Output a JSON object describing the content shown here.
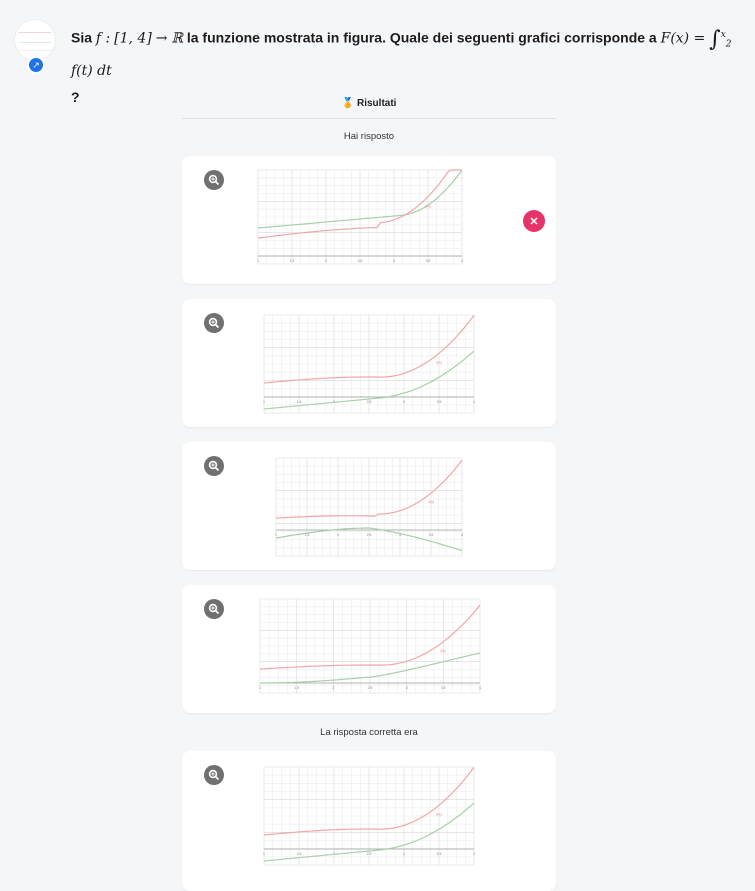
{
  "question": {
    "prefix": "Sia",
    "f_name": "f",
    "domain": "[1, 4]",
    "arrow": "→",
    "codomain": "ℝ",
    "text": "la funzione mostrata in figura. Quale dei seguenti grafici corrisponde a",
    "F_expr": "F(x) =",
    "integral_sign": "∫",
    "upper": "x",
    "lower": "2",
    "integrand": "f(t) dt",
    "suffix": "?"
  },
  "results": {
    "title": "Risultati",
    "icon": "badge-icon",
    "answered_label": "Hai risposto",
    "correct_label": "La risposta corretta era"
  },
  "colors": {
    "f_curve": "#f2a7a7",
    "F_curve": "#a9cfa9",
    "wrong": "#e8336a",
    "zoom": "#707070"
  },
  "cards": [
    {
      "id": "option-1",
      "fx_label": "f(x)",
      "marked": "wrong",
      "ticks": [
        "1",
        "1.5",
        "2",
        "2.5",
        "3",
        "3.5",
        "4"
      ]
    },
    {
      "id": "option-2",
      "fx_label": "f(x)",
      "ticks": [
        "1",
        "1.5",
        "2",
        "2.5",
        "3",
        "3.5",
        "4"
      ]
    },
    {
      "id": "option-3",
      "fx_label": "f(x)",
      "ticks": [
        "1",
        "1.5",
        "2",
        "2.5",
        "3",
        "3.5",
        "4"
      ]
    },
    {
      "id": "option-4",
      "fx_label": "f(x)",
      "ticks": [
        "1",
        "1.5",
        "2",
        "2.5",
        "3",
        "3.5",
        "4"
      ]
    },
    {
      "id": "correct",
      "fx_label": "f(x)",
      "ticks": [
        "1",
        "1.5",
        "2",
        "2.5",
        "3",
        "3.5",
        "4"
      ]
    }
  ]
}
